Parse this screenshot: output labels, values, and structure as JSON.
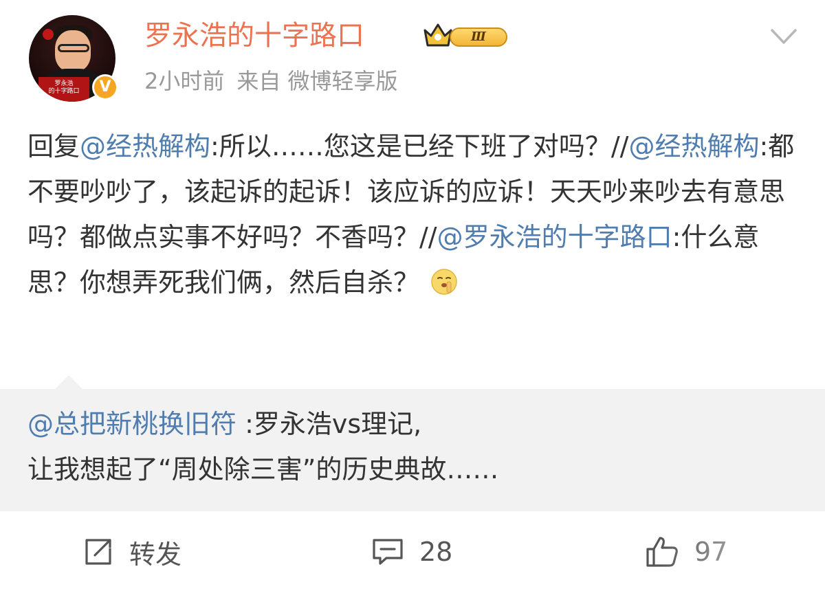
{
  "post": {
    "username": "罗永浩的十字路口",
    "rank_badge": "Ⅲ",
    "time_label": "2小时前",
    "source_label": "来自 微博轻享版",
    "avatar_caption_line1": "罗永浩",
    "avatar_caption_line2": "的十字路口",
    "verified_mark": "V",
    "text_parts": {
      "p1": "回复",
      "m1": "@经热解构",
      "p2": ":所以……您这是已经下班了对吗？//",
      "m2": "@经热解构",
      "p3": ":都不要吵吵了，该起诉的起诉！该应诉的应诉！天天吵来吵去有意思吗？都做点实事不好吗？不香吗？//",
      "m3": "@罗永浩的十字路口",
      "p4": ":什么意思？你想弄死我们俩，然后自杀？"
    },
    "emoji_icon": "shushing-face-emoji"
  },
  "quote": {
    "mention": "@总把新桃换旧符",
    "line1": " :罗永浩vs理记,",
    "line2": "让我想起了“周处除三害”的历史典故……"
  },
  "actions": {
    "repost_label": "转发",
    "comment_count": "28",
    "like_count": "97"
  },
  "colors": {
    "username": "#eb7350",
    "mention": "#507daf",
    "meta": "#999999",
    "quote_bg": "#f2f2f2"
  }
}
